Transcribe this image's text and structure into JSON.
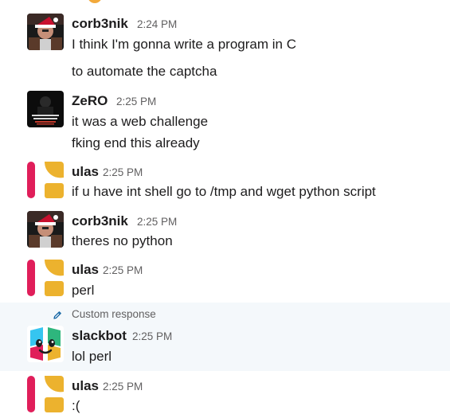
{
  "messages": [
    {
      "user": "corb3nik",
      "time": "2:24 PM",
      "lines": [
        "I think I'm gonna write a program in C",
        "to automate the captcha"
      ],
      "avatar": "corb3nik-avatar"
    },
    {
      "user": "ZeRO",
      "time": "2:25 PM",
      "lines": [
        "it was a web challenge",
        "fking end this already"
      ],
      "avatar": "zero-avatar"
    },
    {
      "user": "ulas",
      "time": "2:25 PM",
      "lines": [
        "if u have int shell go to /tmp and wget python script"
      ],
      "avatar": "ulas-avatar"
    },
    {
      "user": "corb3nik",
      "time": "2:25 PM",
      "lines": [
        "theres no python"
      ],
      "avatar": "corb3nik-avatar"
    },
    {
      "user": "ulas",
      "time": "2:25 PM",
      "lines": [
        "perl"
      ],
      "avatar": "ulas-avatar"
    },
    {
      "custom_label": "Custom response",
      "user": "slackbot",
      "time": "2:25 PM",
      "lines": [
        "lol perl"
      ],
      "avatar": "slackbot-avatar"
    },
    {
      "user": "ulas",
      "time": "2:25 PM",
      "lines": [
        ":("
      ],
      "avatar": "ulas-avatar"
    }
  ],
  "colors": {
    "ulas_red": "#e01e5a",
    "ulas_yellow": "#ecb22e",
    "highlight_bg": "#f4f8fb",
    "time_gray": "#616061"
  }
}
